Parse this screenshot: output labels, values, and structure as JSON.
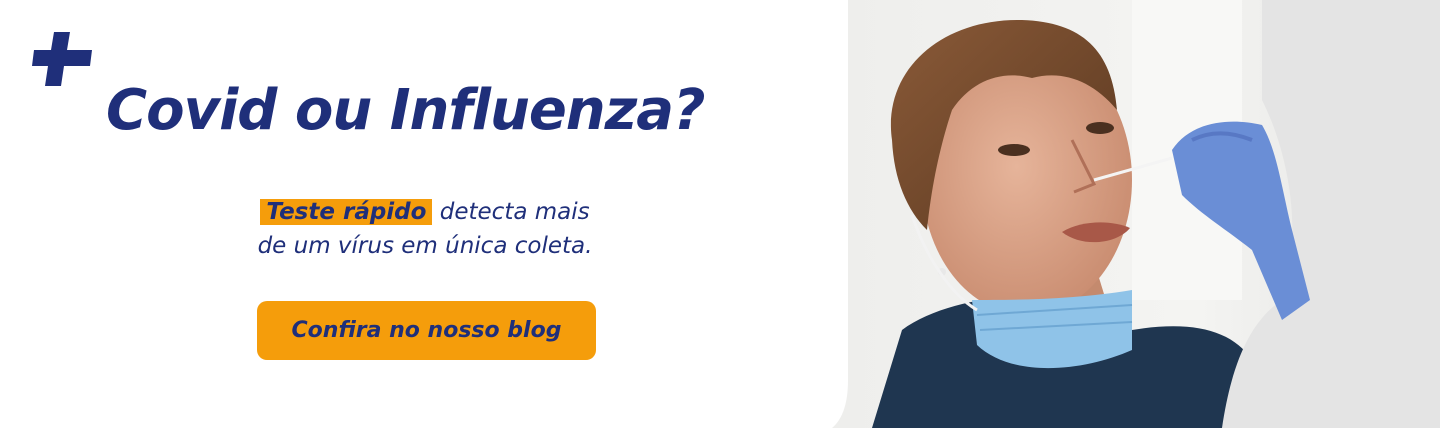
{
  "banner": {
    "title": "Covid ou Influenza?",
    "subtitle": {
      "highlight": "Teste rápido",
      "line1_rest": " detecta mais",
      "line2": "de um vírus em única coleta."
    },
    "cta_label": "Confira no nosso blog"
  },
  "colors": {
    "brand_blue": "#1f2f7a",
    "accent_orange": "#f59d0b",
    "background": "#ffffff"
  },
  "icons": {
    "brand": "plus-icon"
  }
}
